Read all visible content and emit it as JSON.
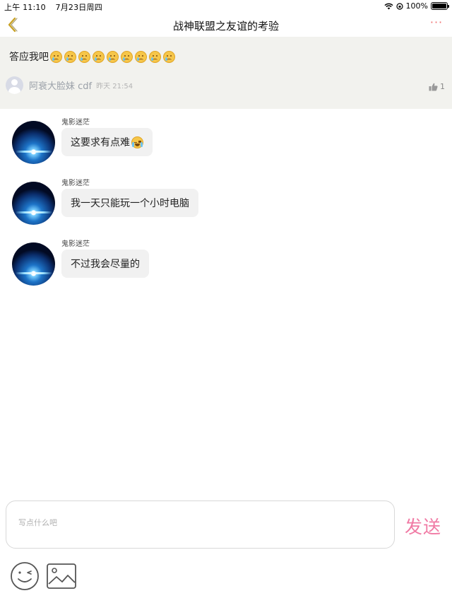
{
  "status_bar": {
    "time": "上午 11:10",
    "date": "7月23日周四",
    "battery": "100%",
    "battery_level": 1.0
  },
  "nav": {
    "title": "战神联盟之友谊的考验",
    "more": "···"
  },
  "post": {
    "text": "答应我吧",
    "emoji_count": 9,
    "author": "阿衰大脸妹 cdf",
    "time": "昨天 21:54",
    "likes": "1"
  },
  "messages": [
    {
      "sender": "鬼影迷茫",
      "text": "这要求有点难",
      "emoji": "crying-face-icon"
    },
    {
      "sender": "鬼影迷茫",
      "text": "我一天只能玩一个小时电脑"
    },
    {
      "sender": "鬼影迷茫",
      "text": "不过我会尽量的"
    }
  ],
  "composer": {
    "placeholder": "写点什么吧",
    "value": "",
    "send_label": "发送"
  },
  "colors": {
    "accent": "#f07aa4",
    "more_accent": "#f07070",
    "back_arrow": "#c9a227"
  }
}
